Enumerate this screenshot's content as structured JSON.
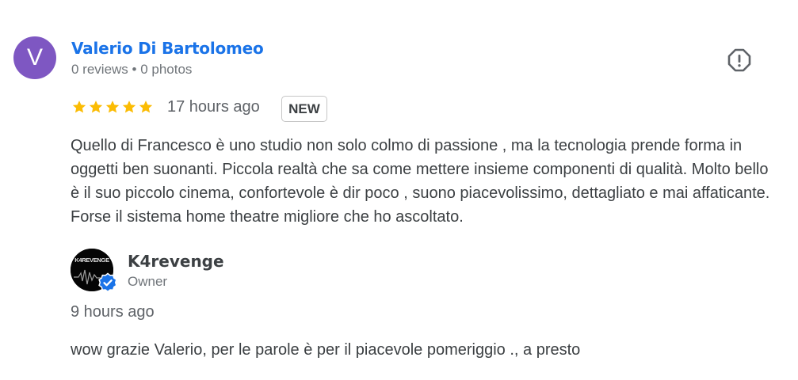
{
  "review": {
    "reviewer": {
      "initial": "V",
      "avatar_color": "#7e57c2",
      "name": "Valerio Di Bartolomeo",
      "meta": "0 reviews • 0 photos"
    },
    "report_icon": "report-flag-icon",
    "rating": 5,
    "star_color": "#fbbc04",
    "time": "17 hours ago",
    "badge": "NEW",
    "text": "Quello di Francesco è uno studio non solo colmo di passione , ma la tecnologia prende forma in oggetti ben suonanti. Piccola realtà che sa come mettere insieme componenti di qualità. Molto bello è il suo piccolo cinema, confortevole è dir poco , suono piacevolissimo, dettagliato e mai affaticante. Forse il sistema home theatre migliore che ho ascoltato."
  },
  "reply": {
    "owner": {
      "name": "K4revenge",
      "role": "Owner",
      "logo_text": "K4REVENGE",
      "verified_color": "#1a73e8"
    },
    "time": "9 hours ago",
    "text": "wow grazie Valerio, per le parole è per il piacevole pomeriggio ., a presto"
  }
}
